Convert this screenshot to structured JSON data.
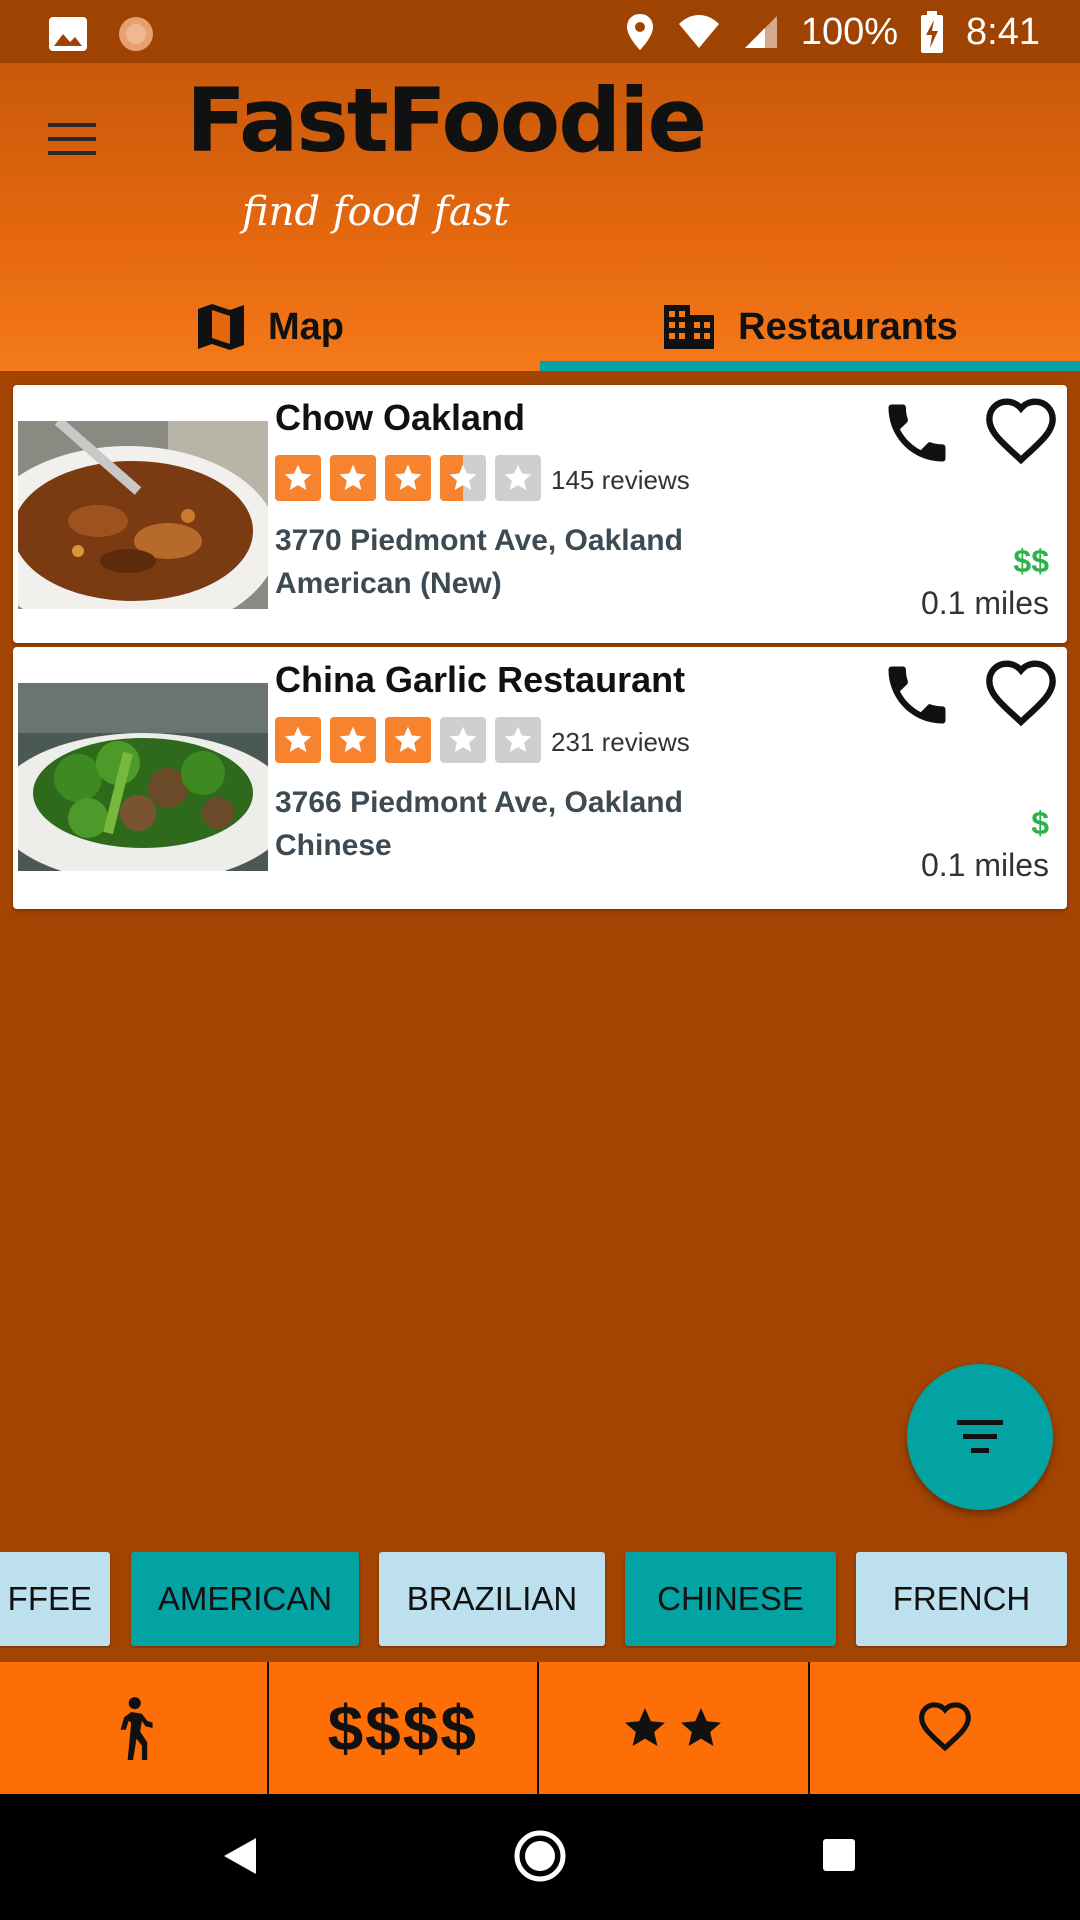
{
  "status_bar": {
    "battery": "100%",
    "time": "8:41"
  },
  "app": {
    "logo_title": "FastFoodie",
    "logo_tagline": "find food fast"
  },
  "tabs": [
    {
      "label": "Map",
      "icon": "map-icon",
      "selected": false
    },
    {
      "label": "Restaurants",
      "icon": "building-icon",
      "selected": true
    }
  ],
  "restaurants": [
    {
      "name": "Chow Oakland",
      "rating": 3.5,
      "reviews": "145 reviews",
      "address": "3770 Piedmont Ave, Oakland",
      "category": "American (New)",
      "price": "$$",
      "distance": "0.1 miles",
      "photo": "stew-photo"
    },
    {
      "name": "China Garlic Restaurant",
      "rating": 3,
      "reviews": "231 reviews",
      "address": "3766 Piedmont Ave, Oakland",
      "category": "Chinese",
      "price": "$",
      "distance": "0.1 miles",
      "photo": "broccoli-photo"
    }
  ],
  "chips": [
    {
      "label": "FFEE",
      "selected": false
    },
    {
      "label": "AMERICAN",
      "selected": true
    },
    {
      "label": "BRAZILIAN",
      "selected": false
    },
    {
      "label": "CHINESE",
      "selected": true
    },
    {
      "label": "FRENCH",
      "selected": false
    }
  ],
  "filters": {
    "distance_icon": "walk-icon",
    "price": "$$$$",
    "rating_stars": 2,
    "favorites_icon": "heart-outline-icon"
  },
  "colors": {
    "accent": "#03A3A3",
    "brand_orange": "#FD6F06",
    "background": "#A34402",
    "star": "#F7832E",
    "price": "#2DB34A",
    "chip_unselected": "#BDE0EE"
  }
}
